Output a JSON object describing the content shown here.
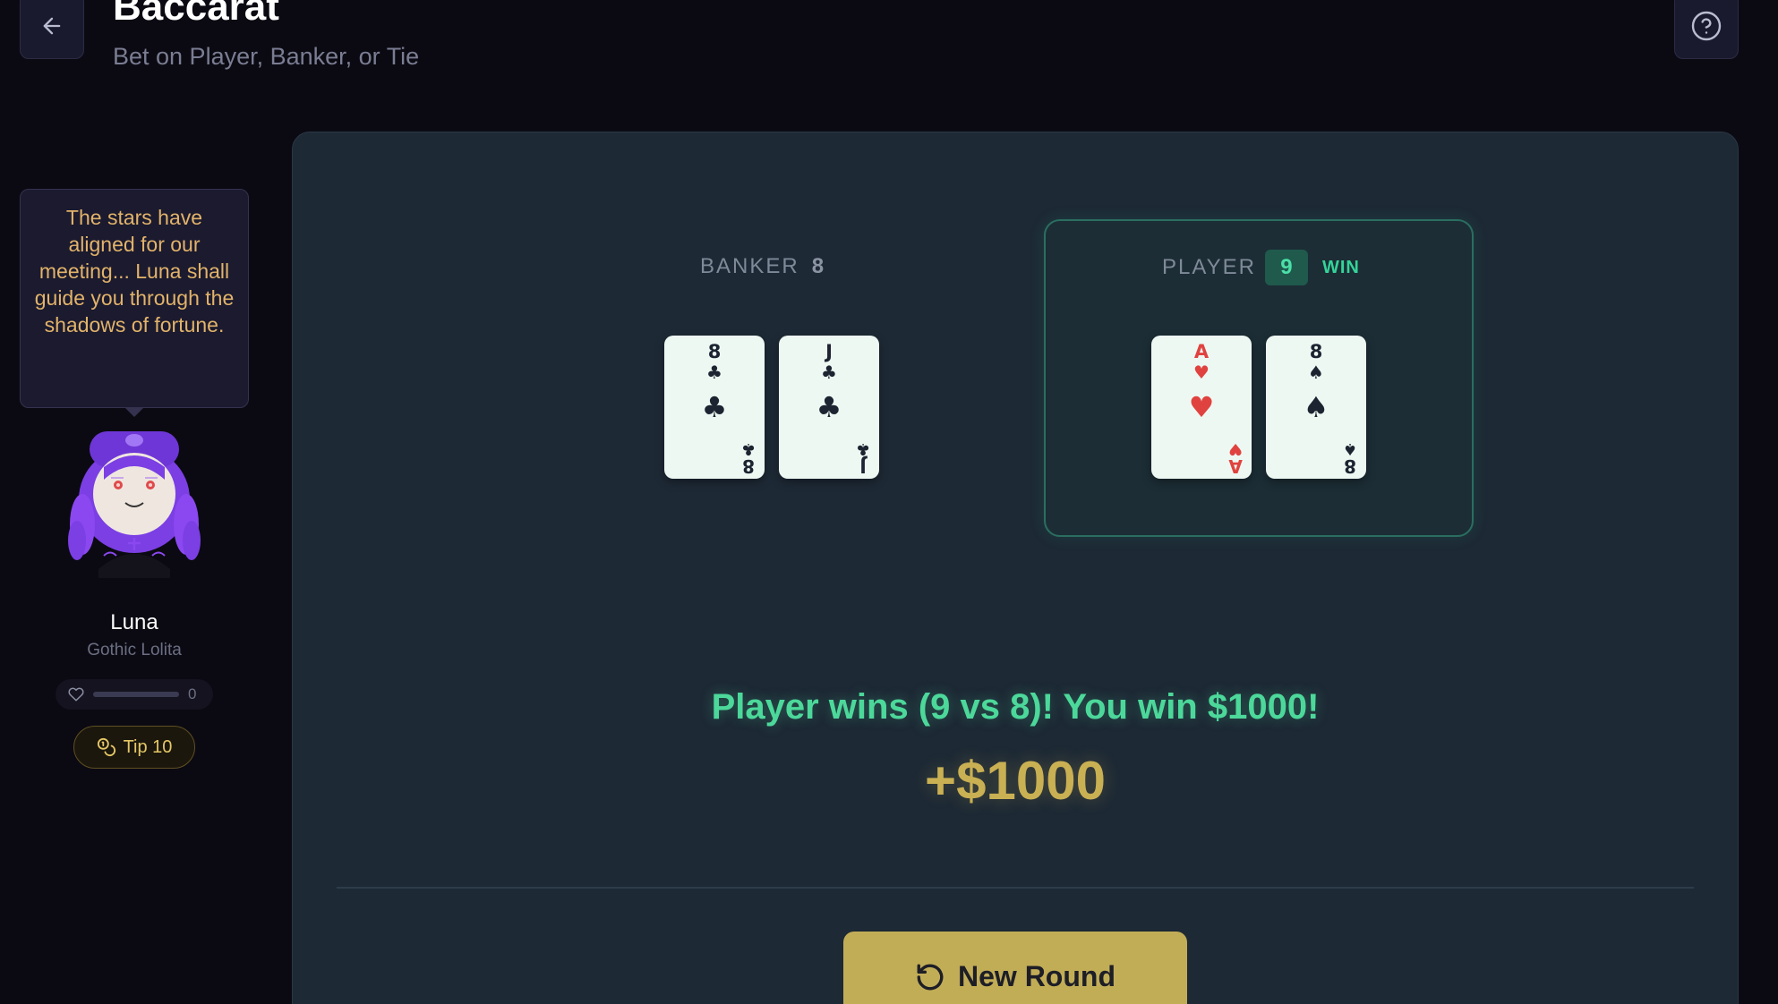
{
  "header": {
    "title": "Baccarat",
    "subtitle": "Bet on Player, Banker, or Tie",
    "back_icon": "arrow-left-icon",
    "help_icon": "question-circle-icon"
  },
  "companion": {
    "speech": "The stars have aligned for our meeting... Luna shall guide you through the shadows of fortune.",
    "name": "Luna",
    "style": "Gothic Lolita",
    "affinity_value": "0",
    "affinity_fraction": 0,
    "tip_label": "Tip 10"
  },
  "banker": {
    "label": "BANKER",
    "score": "8",
    "cards": [
      {
        "rank": "8",
        "suit": "♣",
        "color": "black"
      },
      {
        "rank": "J",
        "suit": "♣",
        "color": "black"
      }
    ]
  },
  "player": {
    "label": "PLAYER",
    "score": "9",
    "status": "WIN",
    "cards": [
      {
        "rank": "A",
        "suit": "♥",
        "color": "red"
      },
      {
        "rank": "8",
        "suit": "♠",
        "color": "black"
      }
    ]
  },
  "result": {
    "message": "Player wins (9 vs 8)! You win $1000!",
    "payout": "+$1000"
  },
  "actions": {
    "new_round_label": "New Round",
    "new_round_icon": "rotate-ccw-icon"
  },
  "colors": {
    "background": "#0b0a12",
    "table": "#1d2935",
    "win_green": "#34d399",
    "gold": "#c2ad57",
    "speech_text": "#e2b36a"
  }
}
